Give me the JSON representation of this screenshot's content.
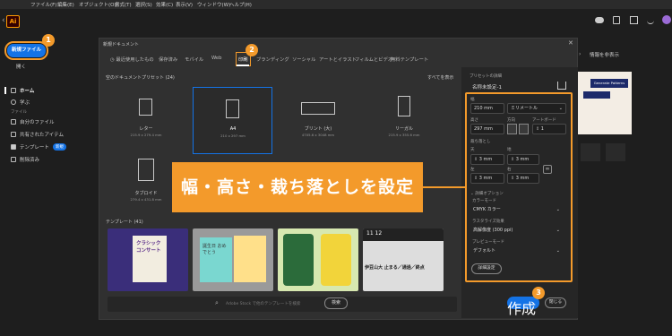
{
  "menubar": {
    "items": [
      "ファイル(F)",
      "編集(E)",
      "オブジェクト(O)",
      "書式(T)",
      "選択(S)",
      "効果(C)",
      "表示(V)",
      "ウィンドウ(W)",
      "ヘルプ(H)"
    ]
  },
  "app": {
    "logo": "Ai",
    "hide_info_label": "情報を非表示",
    "generate_patterns": "Generate Patterns"
  },
  "sidebar": {
    "new_file": "新規ファイル",
    "open": "開く",
    "items": [
      {
        "label": "ホーム",
        "icon": "home-icon"
      },
      {
        "label": "学ぶ",
        "icon": "learn-icon"
      },
      {
        "label": "ファイル",
        "icon": ""
      },
      {
        "label": "自分のファイル",
        "icon": "file-icon"
      },
      {
        "label": "共有されたアイテム",
        "icon": "shared-icon"
      },
      {
        "label": "テンプレート",
        "icon": "template-icon"
      },
      {
        "label": "削除済み",
        "icon": "trash-icon"
      }
    ],
    "new_badge": "新規"
  },
  "dialog": {
    "title": "新規ドキュメント",
    "tabs": [
      "最近使用したもの",
      "保存済み",
      "モバイル",
      "Web",
      "印刷",
      "フィルムとビデオ",
      "アートとイラスト",
      "ソーシャル",
      "ブランディング",
      "無料テンプレート"
    ],
    "section_title": "空のドキュメントプリセット (24)",
    "view_all": "すべてを表示",
    "presets": [
      {
        "name": "レター",
        "size": "215.9 x 279.4 mm"
      },
      {
        "name": "A4",
        "size": "210 x 297 mm"
      },
      {
        "name": "ブリント (大)",
        "size": "4705.6 x 3048 mm"
      },
      {
        "name": "リーガル",
        "size": "215.9 x 355.6 mm"
      },
      {
        "name": "タブロイド",
        "size": "279.4 x 431.8 mm"
      }
    ],
    "templates_title": "テンプレート (41)",
    "template_texts": [
      "クラシック コンサート",
      "誕生日 おめでとう",
      "",
      "11 12",
      "伊豆山大 止まる／通過／終点"
    ],
    "search_placeholder": "Adobe Stock で他のテンプレートを検索",
    "search_button": "検索"
  },
  "preset_details": {
    "header": "プリセットの詳細",
    "name": "名称未設定-1",
    "width_label": "幅",
    "width_value": "210 mm",
    "unit": "ミリメートル",
    "height_label": "高さ",
    "height_value": "297 mm",
    "orientation_label": "方向",
    "artboards_label": "アートボード",
    "artboards_value": "1",
    "bleed_label": "裁ち落とし",
    "top_label": "天",
    "bottom_label": "地",
    "left_label": "左",
    "right_label": "右",
    "bleed_top": "3 mm",
    "bleed_bottom": "3 mm",
    "bleed_left": "3 mm",
    "bleed_right": "3 mm",
    "advanced_label": "詳細オプション",
    "color_mode_label": "カラーモード",
    "color_mode": "CMYK カラー",
    "raster_label": "ラスタライズ効果",
    "raster": "高解像度 (300 ppi)",
    "preview_label": "プレビューモード",
    "preview": "デフォルト",
    "more_settings": "詳細設定",
    "create": "作成",
    "close": "閉じる"
  },
  "callout": "幅・高さ・裁ち落としを設定",
  "badges": [
    "1",
    "2",
    "3"
  ]
}
